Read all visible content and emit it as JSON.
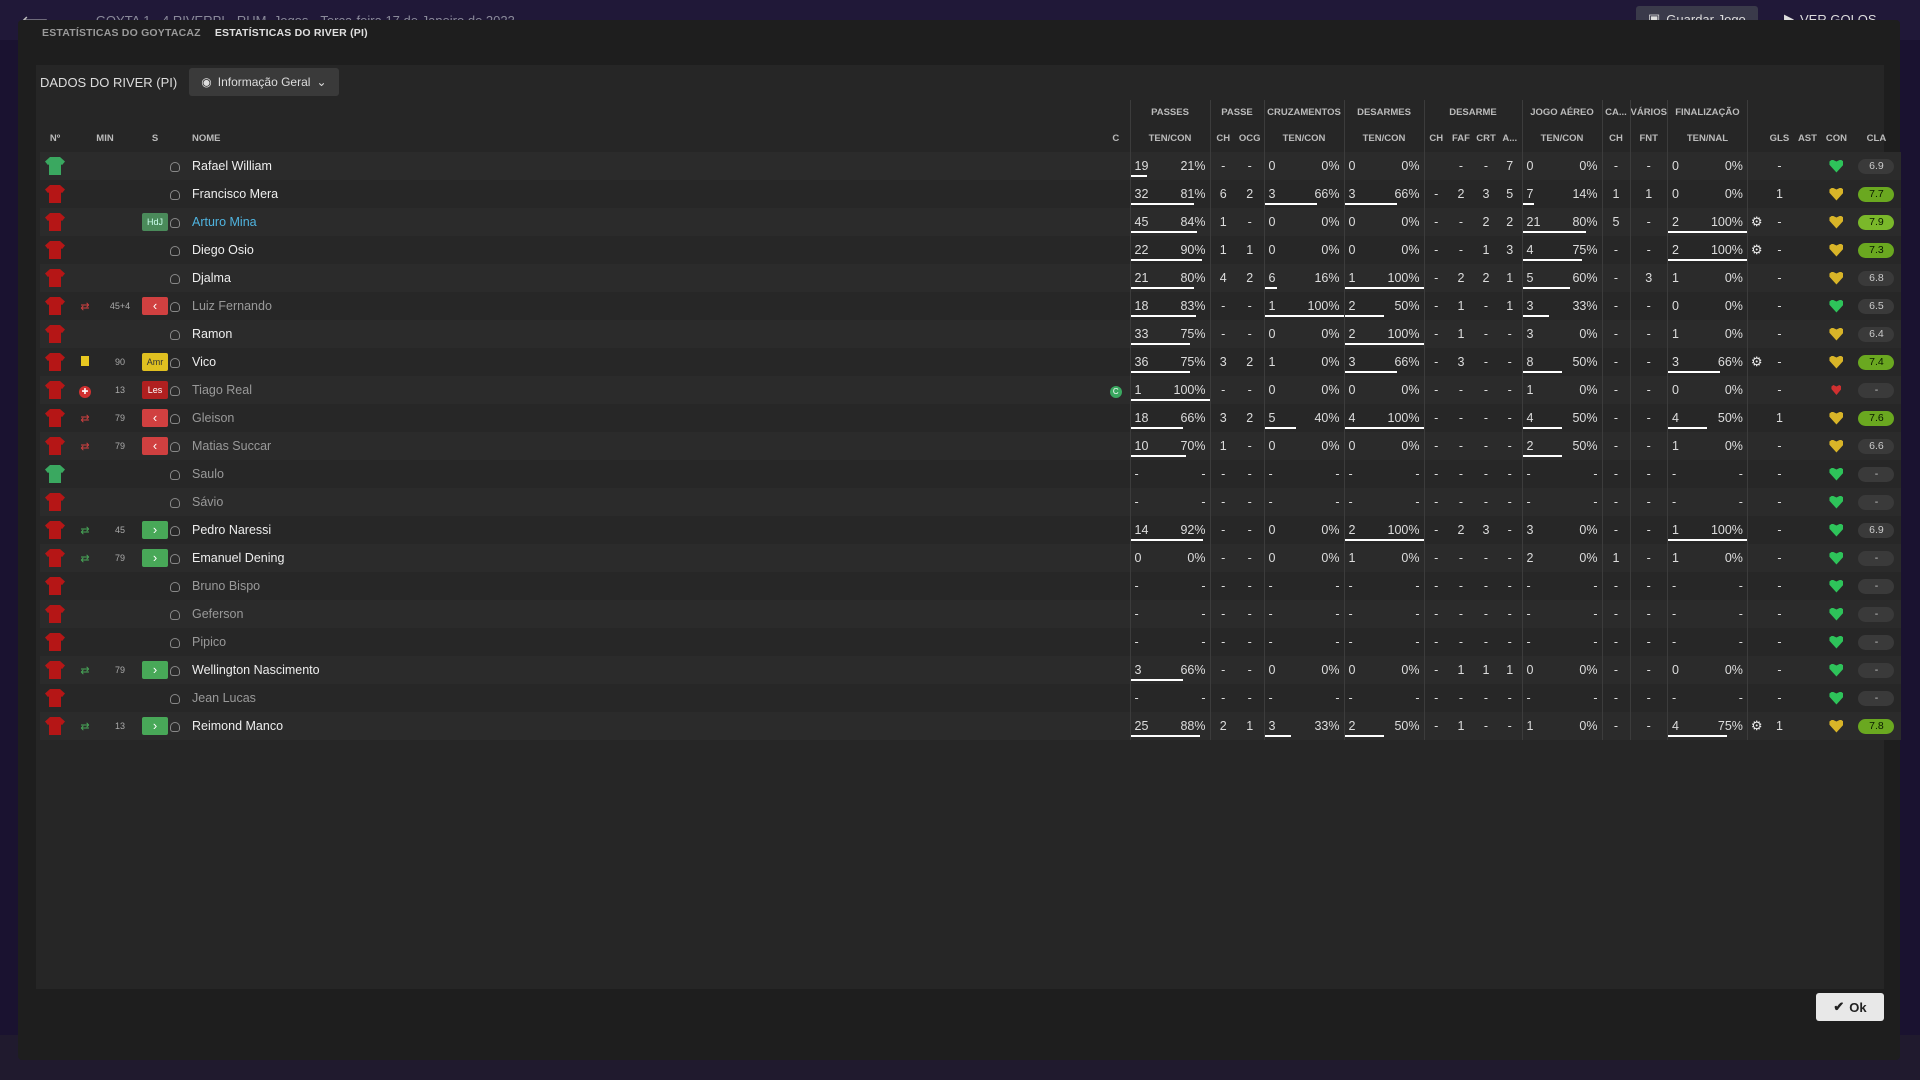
{
  "background": {
    "match": "GOYTA  1 - 4  RIVERPI",
    "stadium": "RHM, Jogos",
    "date": "Terça-feira 17 de Janeiro de 2023",
    "save_label": "Guardar Jogo",
    "goals_label": "VER GOLOS"
  },
  "tabs": [
    {
      "label": "ESTATÍSTICAS DO GOYTACAZ"
    },
    {
      "label": "ESTATÍSTICAS DO RIVER (PI)"
    }
  ],
  "header": {
    "title": "DADOS DO RIVER (PI)",
    "dropdown": "Informação Geral"
  },
  "groups": {
    "passes": "PASSES",
    "passe": "PASSE",
    "cruz": "CRUZAMENTOS",
    "des": "DESARMES",
    "desarme": "DESARME",
    "aereo": "JOGO AÉREO",
    "ca": "CA...",
    "varios": "VÁRIOS",
    "fin": "FINALIZAÇÃO"
  },
  "columns": {
    "no": "Nº",
    "min": "MIN",
    "s": "S",
    "nome": "NOME",
    "c": "C",
    "passes": "TEN/CON",
    "ch": "CH",
    "ocg": "OCG",
    "cruz": "TEN/CON",
    "des": "TEN/CON",
    "dch": "CH",
    "faf": "FAF",
    "crt": "CRT",
    "a": "A...",
    "aereo": "TEN/CON",
    "cach": "CH",
    "fnt": "FNT",
    "fin": "TEN/NAL",
    "gls": "GLS",
    "ast": "AST",
    "con": "CON",
    "cla": "CLA"
  },
  "rows": [
    {
      "gk": true,
      "min": "",
      "s": "",
      "name": "Rafael William",
      "c": "",
      "p": [
        "19",
        "21%"
      ],
      "pw": 21,
      "ch": "-",
      "ocg": "-",
      "cr": [
        "0",
        "0%"
      ],
      "crw": 0,
      "de": [
        "0",
        "0%"
      ],
      "dew": 0,
      "dch": "",
      "faf": "-",
      "crt": "-",
      "a": "7",
      "ae": [
        "0",
        "0%"
      ],
      "aew": 0,
      "cach": "-",
      "fnt": "-",
      "fi": [
        "0",
        "0%"
      ],
      "fiw": 0,
      "gear": "",
      "gls": "-",
      "ast": "",
      "con": "g",
      "cla": "6.9",
      "cc": ""
    },
    {
      "min": "",
      "s": "",
      "name": "Francisco Mera",
      "c": "",
      "p": [
        "32",
        "81%"
      ],
      "pw": 81,
      "ch": "6",
      "ocg": "2",
      "cr": [
        "3",
        "66%"
      ],
      "crw": 66,
      "de": [
        "3",
        "66%"
      ],
      "dew": 66,
      "dch": "-",
      "faf": "2",
      "crt": "3",
      "a": "5",
      "ae": [
        "7",
        "14%"
      ],
      "aew": 14,
      "cach": "1",
      "fnt": "1",
      "fi": [
        "0",
        "0%"
      ],
      "fiw": 0,
      "gear": "",
      "gls": "1",
      "ast": "",
      "con": "y",
      "cla": "7.7",
      "cc": "g"
    },
    {
      "min": "",
      "s": "HdJ",
      "name": "Arturo Mina",
      "hl": true,
      "c": "",
      "p": [
        "45",
        "84%"
      ],
      "pw": 84,
      "ch": "1",
      "ocg": "-",
      "cr": [
        "0",
        "0%"
      ],
      "crw": 0,
      "de": [
        "0",
        "0%"
      ],
      "dew": 0,
      "dch": "-",
      "faf": "-",
      "crt": "2",
      "a": "2",
      "ae": [
        "21",
        "80%"
      ],
      "aew": 80,
      "cach": "5",
      "fnt": "-",
      "fi": [
        "2",
        "100%"
      ],
      "fiw": 100,
      "gear": "⚙",
      "gls": "-",
      "ast": "",
      "con": "y",
      "cla": "7.9",
      "cc": "gg"
    },
    {
      "min": "",
      "s": "",
      "name": "Diego Osio",
      "c": "",
      "p": [
        "22",
        "90%"
      ],
      "pw": 90,
      "ch": "1",
      "ocg": "1",
      "cr": [
        "0",
        "0%"
      ],
      "crw": 0,
      "de": [
        "0",
        "0%"
      ],
      "dew": 0,
      "dch": "-",
      "faf": "-",
      "crt": "1",
      "a": "3",
      "ae": [
        "4",
        "75%"
      ],
      "aew": 75,
      "cach": "-",
      "fnt": "-",
      "fi": [
        "2",
        "100%"
      ],
      "fiw": 100,
      "gear": "⚙",
      "gls": "-",
      "ast": "",
      "con": "y",
      "cla": "7.3",
      "cc": "g"
    },
    {
      "min": "",
      "s": "",
      "name": "Djalma",
      "c": "",
      "p": [
        "21",
        "80%"
      ],
      "pw": 80,
      "ch": "4",
      "ocg": "2",
      "cr": [
        "6",
        "16%"
      ],
      "crw": 16,
      "de": [
        "1",
        "100%"
      ],
      "dew": 100,
      "dch": "-",
      "faf": "2",
      "crt": "2",
      "a": "1",
      "ae": [
        "5",
        "60%"
      ],
      "aew": 60,
      "cach": "-",
      "fnt": "3",
      "fi": [
        "1",
        "0%"
      ],
      "fiw": 0,
      "gear": "",
      "gls": "-",
      "ast": "",
      "con": "y",
      "cla": "6.8",
      "cc": ""
    },
    {
      "min": "45+4",
      "s": "out",
      "sw": "r",
      "name": "Luiz Fernando",
      "sub": true,
      "c": "",
      "p": [
        "18",
        "83%"
      ],
      "pw": 83,
      "ch": "-",
      "ocg": "-",
      "cr": [
        "1",
        "100%"
      ],
      "crw": 100,
      "de": [
        "2",
        "50%"
      ],
      "dew": 50,
      "dch": "-",
      "faf": "1",
      "crt": "-",
      "a": "1",
      "ae": [
        "3",
        "33%"
      ],
      "aew": 33,
      "cach": "-",
      "fnt": "-",
      "fi": [
        "0",
        "0%"
      ],
      "fiw": 0,
      "gear": "",
      "gls": "-",
      "ast": "",
      "con": "g",
      "cla": "6.5",
      "cc": ""
    },
    {
      "min": "",
      "s": "",
      "name": "Ramon",
      "c": "",
      "p": [
        "33",
        "75%"
      ],
      "pw": 75,
      "ch": "-",
      "ocg": "-",
      "cr": [
        "0",
        "0%"
      ],
      "crw": 0,
      "de": [
        "2",
        "100%"
      ],
      "dew": 100,
      "dch": "-",
      "faf": "1",
      "crt": "-",
      "a": "-",
      "ae": [
        "3",
        "0%"
      ],
      "aew": 0,
      "cach": "-",
      "fnt": "-",
      "fi": [
        "1",
        "0%"
      ],
      "fiw": 0,
      "gear": "",
      "gls": "-",
      "ast": "",
      "con": "y",
      "cla": "6.4",
      "cc": ""
    },
    {
      "min": "90",
      "s": "Amr",
      "card": true,
      "name": "Vico",
      "c": "",
      "p": [
        "36",
        "75%"
      ],
      "pw": 75,
      "ch": "3",
      "ocg": "2",
      "cr": [
        "1",
        "0%"
      ],
      "crw": 0,
      "de": [
        "3",
        "66%"
      ],
      "dew": 66,
      "dch": "-",
      "faf": "3",
      "crt": "-",
      "a": "-",
      "ae": [
        "8",
        "50%"
      ],
      "aew": 50,
      "cach": "-",
      "fnt": "-",
      "fi": [
        "3",
        "66%"
      ],
      "fiw": 66,
      "gear": "⚙",
      "gls": "-",
      "ast": "",
      "con": "y",
      "cla": "7.4",
      "cc": "g"
    },
    {
      "min": "13",
      "s": "Les",
      "inj": true,
      "name": "Tiago Real",
      "sub": true,
      "c": "C",
      "p": [
        "1",
        "100%"
      ],
      "pw": 100,
      "ch": "-",
      "ocg": "-",
      "cr": [
        "0",
        "0%"
      ],
      "crw": 0,
      "de": [
        "0",
        "0%"
      ],
      "dew": 0,
      "dch": "-",
      "faf": "-",
      "crt": "-",
      "a": "-",
      "ae": [
        "1",
        "0%"
      ],
      "aew": 0,
      "cach": "-",
      "fnt": "-",
      "fi": [
        "0",
        "0%"
      ],
      "fiw": 0,
      "gear": "",
      "gls": "-",
      "ast": "",
      "con": "r",
      "cla": "-",
      "cc": ""
    },
    {
      "min": "79",
      "s": "out",
      "sw": "r",
      "name": "Gleison",
      "sub": true,
      "c": "",
      "p": [
        "18",
        "66%"
      ],
      "pw": 66,
      "ch": "3",
      "ocg": "2",
      "cr": [
        "5",
        "40%"
      ],
      "crw": 40,
      "de": [
        "4",
        "100%"
      ],
      "dew": 100,
      "dch": "-",
      "faf": "-",
      "crt": "-",
      "a": "-",
      "ae": [
        "4",
        "50%"
      ],
      "aew": 50,
      "cach": "-",
      "fnt": "-",
      "fi": [
        "4",
        "50%"
      ],
      "fiw": 50,
      "gear": "",
      "gls": "1",
      "ast": "",
      "con": "y",
      "cla": "7.6",
      "cc": "g"
    },
    {
      "min": "79",
      "s": "out",
      "sw": "r",
      "name": "Matias Succar",
      "sub": true,
      "c": "",
      "p": [
        "10",
        "70%"
      ],
      "pw": 70,
      "ch": "1",
      "ocg": "-",
      "cr": [
        "0",
        "0%"
      ],
      "crw": 0,
      "de": [
        "0",
        "0%"
      ],
      "dew": 0,
      "dch": "-",
      "faf": "-",
      "crt": "-",
      "a": "-",
      "ae": [
        "2",
        "50%"
      ],
      "aew": 50,
      "cach": "-",
      "fnt": "-",
      "fi": [
        "1",
        "0%"
      ],
      "fiw": 0,
      "gear": "",
      "gls": "-",
      "ast": "",
      "con": "y",
      "cla": "6.6",
      "cc": ""
    },
    {
      "gk": true,
      "min": "",
      "s": "",
      "name": "Saulo",
      "sub": true,
      "c": "",
      "p": [
        "-",
        "-"
      ],
      "pw": 0,
      "ch": "-",
      "ocg": "-",
      "cr": [
        "-",
        "-"
      ],
      "crw": 0,
      "de": [
        "-",
        "-"
      ],
      "dew": 0,
      "dch": "-",
      "faf": "-",
      "crt": "-",
      "a": "-",
      "ae": [
        "-",
        "-"
      ],
      "aew": 0,
      "cach": "-",
      "fnt": "-",
      "fi": [
        "-",
        "-"
      ],
      "fiw": 0,
      "gear": "",
      "gls": "-",
      "ast": "",
      "con": "g",
      "cla": "-",
      "cc": ""
    },
    {
      "min": "",
      "s": "",
      "name": "Sávio",
      "sub": true,
      "c": "",
      "p": [
        "-",
        "-"
      ],
      "pw": 0,
      "ch": "-",
      "ocg": "-",
      "cr": [
        "-",
        "-"
      ],
      "crw": 0,
      "de": [
        "-",
        "-"
      ],
      "dew": 0,
      "dch": "-",
      "faf": "-",
      "crt": "-",
      "a": "-",
      "ae": [
        "-",
        "-"
      ],
      "aew": 0,
      "cach": "-",
      "fnt": "-",
      "fi": [
        "-",
        "-"
      ],
      "fiw": 0,
      "gear": "",
      "gls": "-",
      "ast": "",
      "con": "g",
      "cla": "-",
      "cc": ""
    },
    {
      "min": "45",
      "s": "in",
      "sw": "g",
      "name": "Pedro Naressi",
      "c": "",
      "p": [
        "14",
        "92%"
      ],
      "pw": 92,
      "ch": "-",
      "ocg": "-",
      "cr": [
        "0",
        "0%"
      ],
      "crw": 0,
      "de": [
        "2",
        "100%"
      ],
      "dew": 100,
      "dch": "-",
      "faf": "2",
      "crt": "3",
      "a": "-",
      "ae": [
        "3",
        "0%"
      ],
      "aew": 0,
      "cach": "-",
      "fnt": "-",
      "fi": [
        "1",
        "100%"
      ],
      "fiw": 100,
      "gear": "",
      "gls": "-",
      "ast": "",
      "con": "g",
      "cla": "6.9",
      "cc": ""
    },
    {
      "min": "79",
      "s": "in",
      "sw": "g",
      "name": "Emanuel Dening",
      "c": "",
      "p": [
        "0",
        "0%"
      ],
      "pw": 0,
      "ch": "-",
      "ocg": "-",
      "cr": [
        "0",
        "0%"
      ],
      "crw": 0,
      "de": [
        "1",
        "0%"
      ],
      "dew": 0,
      "dch": "-",
      "faf": "-",
      "crt": "-",
      "a": "-",
      "ae": [
        "2",
        "0%"
      ],
      "aew": 0,
      "cach": "1",
      "fnt": "-",
      "fi": [
        "1",
        "0%"
      ],
      "fiw": 0,
      "gear": "",
      "gls": "-",
      "ast": "",
      "con": "g",
      "cla": "-",
      "cc": ""
    },
    {
      "min": "",
      "s": "",
      "name": "Bruno Bispo",
      "sub": true,
      "c": "",
      "p": [
        "-",
        "-"
      ],
      "pw": 0,
      "ch": "-",
      "ocg": "-",
      "cr": [
        "-",
        "-"
      ],
      "crw": 0,
      "de": [
        "-",
        "-"
      ],
      "dew": 0,
      "dch": "-",
      "faf": "-",
      "crt": "-",
      "a": "-",
      "ae": [
        "-",
        "-"
      ],
      "aew": 0,
      "cach": "-",
      "fnt": "-",
      "fi": [
        "-",
        "-"
      ],
      "fiw": 0,
      "gear": "",
      "gls": "-",
      "ast": "",
      "con": "g",
      "cla": "-",
      "cc": ""
    },
    {
      "min": "",
      "s": "",
      "name": "Geferson",
      "sub": true,
      "c": "",
      "p": [
        "-",
        "-"
      ],
      "pw": 0,
      "ch": "-",
      "ocg": "-",
      "cr": [
        "-",
        "-"
      ],
      "crw": 0,
      "de": [
        "-",
        "-"
      ],
      "dew": 0,
      "dch": "-",
      "faf": "-",
      "crt": "-",
      "a": "-",
      "ae": [
        "-",
        "-"
      ],
      "aew": 0,
      "cach": "-",
      "fnt": "-",
      "fi": [
        "-",
        "-"
      ],
      "fiw": 0,
      "gear": "",
      "gls": "-",
      "ast": "",
      "con": "g",
      "cla": "-",
      "cc": ""
    },
    {
      "min": "",
      "s": "",
      "name": "Pipico",
      "sub": true,
      "c": "",
      "p": [
        "-",
        "-"
      ],
      "pw": 0,
      "ch": "-",
      "ocg": "-",
      "cr": [
        "-",
        "-"
      ],
      "crw": 0,
      "de": [
        "-",
        "-"
      ],
      "dew": 0,
      "dch": "-",
      "faf": "-",
      "crt": "-",
      "a": "-",
      "ae": [
        "-",
        "-"
      ],
      "aew": 0,
      "cach": "-",
      "fnt": "-",
      "fi": [
        "-",
        "-"
      ],
      "fiw": 0,
      "gear": "",
      "gls": "-",
      "ast": "",
      "con": "g",
      "cla": "-",
      "cc": ""
    },
    {
      "min": "79",
      "s": "in",
      "sw": "g",
      "name": "Wellington Nascimento",
      "c": "",
      "p": [
        "3",
        "66%"
      ],
      "pw": 66,
      "ch": "-",
      "ocg": "-",
      "cr": [
        "0",
        "0%"
      ],
      "crw": 0,
      "de": [
        "0",
        "0%"
      ],
      "dew": 0,
      "dch": "-",
      "faf": "1",
      "crt": "1",
      "a": "1",
      "ae": [
        "0",
        "0%"
      ],
      "aew": 0,
      "cach": "-",
      "fnt": "-",
      "fi": [
        "0",
        "0%"
      ],
      "fiw": 0,
      "gear": "",
      "gls": "-",
      "ast": "",
      "con": "g",
      "cla": "-",
      "cc": ""
    },
    {
      "min": "",
      "s": "",
      "name": "Jean Lucas",
      "sub": true,
      "c": "",
      "p": [
        "-",
        "-"
      ],
      "pw": 0,
      "ch": "-",
      "ocg": "-",
      "cr": [
        "-",
        "-"
      ],
      "crw": 0,
      "de": [
        "-",
        "-"
      ],
      "dew": 0,
      "dch": "-",
      "faf": "-",
      "crt": "-",
      "a": "-",
      "ae": [
        "-",
        "-"
      ],
      "aew": 0,
      "cach": "-",
      "fnt": "-",
      "fi": [
        "-",
        "-"
      ],
      "fiw": 0,
      "gear": "",
      "gls": "-",
      "ast": "",
      "con": "g",
      "cla": "-",
      "cc": ""
    },
    {
      "min": "13",
      "s": "in",
      "sw": "g",
      "name": "Reimond Manco",
      "c": "",
      "p": [
        "25",
        "88%"
      ],
      "pw": 88,
      "ch": "2",
      "ocg": "1",
      "cr": [
        "3",
        "33%"
      ],
      "crw": 33,
      "de": [
        "2",
        "50%"
      ],
      "dew": 50,
      "dch": "-",
      "faf": "1",
      "crt": "-",
      "a": "-",
      "ae": [
        "1",
        "0%"
      ],
      "aew": 0,
      "cach": "-",
      "fnt": "-",
      "fi": [
        "4",
        "75%"
      ],
      "fiw": 75,
      "gear": "⚙",
      "gls": "1",
      "ast": "",
      "con": "y",
      "cla": "7.8",
      "cc": "g"
    }
  ],
  "ok_label": "Ok",
  "colors": {
    "accent_green": "#6aa820",
    "shirt_red": "#b51616",
    "keeper_green": "#3aa860"
  }
}
